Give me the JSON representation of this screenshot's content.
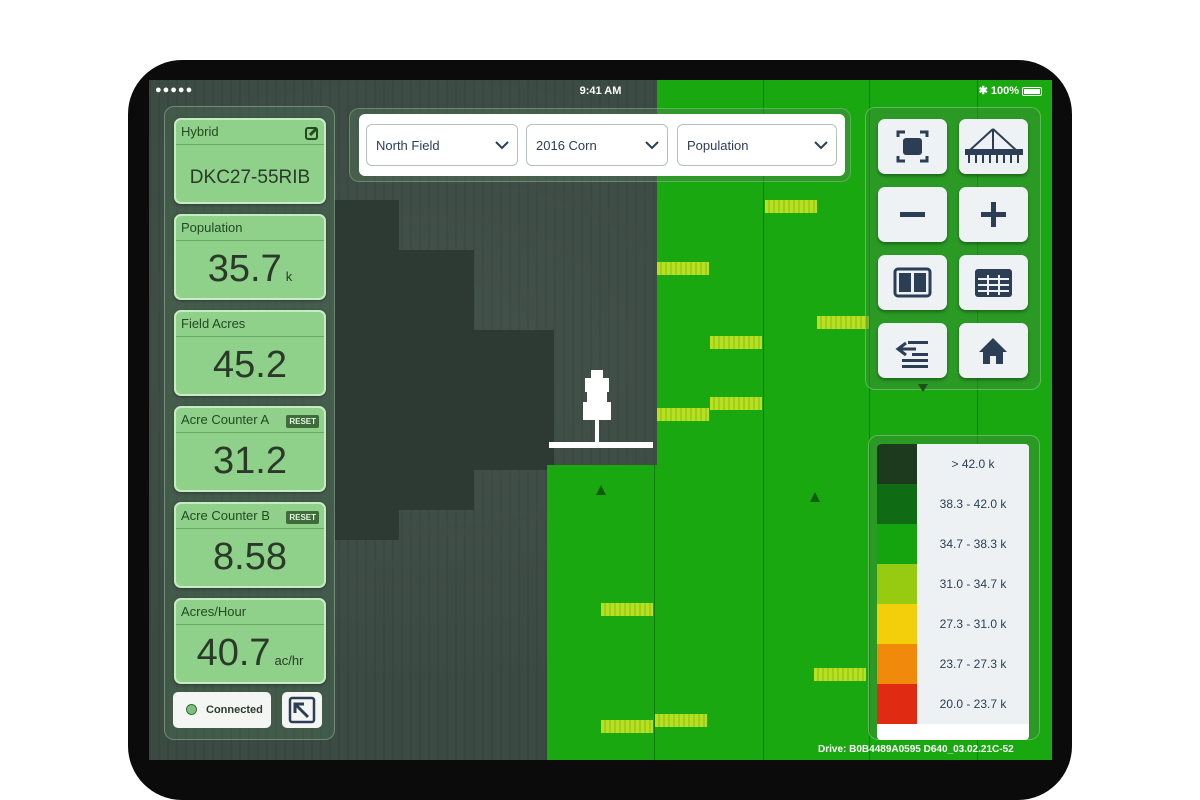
{
  "status_bar": {
    "signal": "●●●●●",
    "time": "9:41 AM",
    "battery": "100%"
  },
  "stats": [
    {
      "label": "Hybrid",
      "value": "DKC27-55RIB",
      "unit": "",
      "action": "edit-icon"
    },
    {
      "label": "Population",
      "value": "35.7",
      "unit": "k",
      "action": ""
    },
    {
      "label": "Field Acres",
      "value": "45.2",
      "unit": "",
      "action": ""
    },
    {
      "label": "Acre Counter A",
      "value": "31.2",
      "unit": "",
      "action": "RESET"
    },
    {
      "label": "Acre Counter B",
      "value": "8.58",
      "unit": "",
      "action": "RESET"
    },
    {
      "label": "Acres/Hour",
      "value": "40.7",
      "unit": "ac/hr",
      "action": ""
    }
  ],
  "connection": {
    "label": "Connected",
    "status_color": "#7fbf7f"
  },
  "selectors": [
    {
      "value": "North Field"
    },
    {
      "value": "2016 Corn"
    },
    {
      "value": "Population"
    }
  ],
  "controls": [
    "fit-to-screen-icon",
    "planter-icon",
    "zoom-out-icon",
    "zoom-in-icon",
    "split-view-icon",
    "table-icon",
    "layers-icon",
    "home-icon"
  ],
  "legend": [
    {
      "label": "> 42.0 k",
      "color": "#1e3a1e"
    },
    {
      "label": "38.3 - 42.0 k",
      "color": "#0f6b14"
    },
    {
      "label": "34.7 - 38.3 k",
      "color": "#14a40e"
    },
    {
      "label": "31.0 - 34.7 k",
      "color": "#97cb12"
    },
    {
      "label": "27.3 - 31.0 k",
      "color": "#f3cf0b"
    },
    {
      "label": "23.7 - 27.3 k",
      "color": "#f18a0a"
    },
    {
      "label": "20.0 - 23.7 k",
      "color": "#e02a12"
    }
  ],
  "footer": "Drive: B0B4489A0595 D640_03.02.21C-52",
  "colors": {
    "map_green": "#19a80f",
    "card_green": "#8fd08a",
    "accent_text": "#2b3e55"
  }
}
